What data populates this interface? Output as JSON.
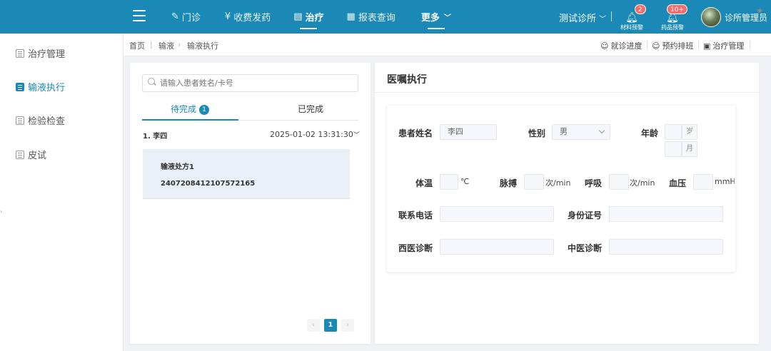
{
  "topbar": {
    "nav": [
      {
        "label": "门诊",
        "icon": "edit-icon"
      },
      {
        "label": "收费发药",
        "icon": "yen-icon"
      },
      {
        "label": "治疗",
        "icon": "treatment-icon"
      },
      {
        "label": "报表查询",
        "icon": "report-icon"
      },
      {
        "label": "更多",
        "icon": "chevron-down-icon"
      }
    ],
    "clinic": "测试诊所",
    "alerts": [
      {
        "label": "材料预警",
        "count": "2"
      },
      {
        "label": "药品预警",
        "count": "10+"
      }
    ],
    "user": "诊所管理员"
  },
  "sidebar": {
    "items": [
      {
        "label": "治疗管理"
      },
      {
        "label": "输液执行"
      },
      {
        "label": "检验检查"
      },
      {
        "label": "皮试"
      }
    ]
  },
  "breadcrumb": {
    "home": "首页",
    "level1": "输液",
    "level2": "输液执行"
  },
  "quicklinks": {
    "visit_progress": "就诊进度",
    "schedule": "预约排班",
    "treatment_mgmt": "治疗管理"
  },
  "left": {
    "search_placeholder": "请输入患者姓名/卡号",
    "tab_pending": "待完成",
    "tab_pending_count": "1",
    "tab_done": "已完成",
    "patient_name": "1. 李四",
    "patient_time": "2025-01-02 13:31:30",
    "rx_title": "输液处方1",
    "rx_code": "2407208412107572165",
    "page": "1"
  },
  "right": {
    "title": "医嘱执行",
    "name_label": "患者姓名",
    "name_value": "李四",
    "gender_label": "性别",
    "gender_value": "男",
    "age_label": "年龄",
    "age_unit_year": "岁",
    "age_unit_month": "月",
    "temp_label": "体温",
    "temp_unit": "℃",
    "pulse_label": "脉搏",
    "pulse_unit": "次/min",
    "resp_label": "呼吸",
    "resp_unit": "次/min",
    "bp_label": "血压",
    "bp_unit": "mmH",
    "phone_label": "联系电话",
    "id_label": "身份证号",
    "wdiag_label": "西医诊断",
    "cdiag_label": "中医诊断"
  },
  "colors": {
    "primary": "#1a89b5",
    "badge": "#f56c6c"
  }
}
